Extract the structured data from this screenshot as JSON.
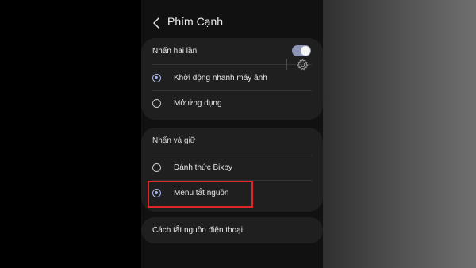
{
  "header": {
    "title": "Phím Cạnh"
  },
  "double_press": {
    "section_label": "Nhấn hai lần",
    "toggle_on": true,
    "options": [
      {
        "label": "Khởi động nhanh máy ảnh",
        "selected": true
      },
      {
        "label": "Mở ứng dụng",
        "selected": false
      }
    ]
  },
  "press_and_hold": {
    "section_label": "Nhấn và giữ",
    "options": [
      {
        "label": "Đánh thức Bixby",
        "selected": false
      },
      {
        "label": "Menu tắt nguồn",
        "selected": true
      }
    ]
  },
  "power_off_link": {
    "label": "Cách tắt nguồn điện thoại"
  },
  "colors": {
    "accent": "#a9b7e6",
    "highlight": "#e0262d",
    "card": "#1f1f1f"
  }
}
